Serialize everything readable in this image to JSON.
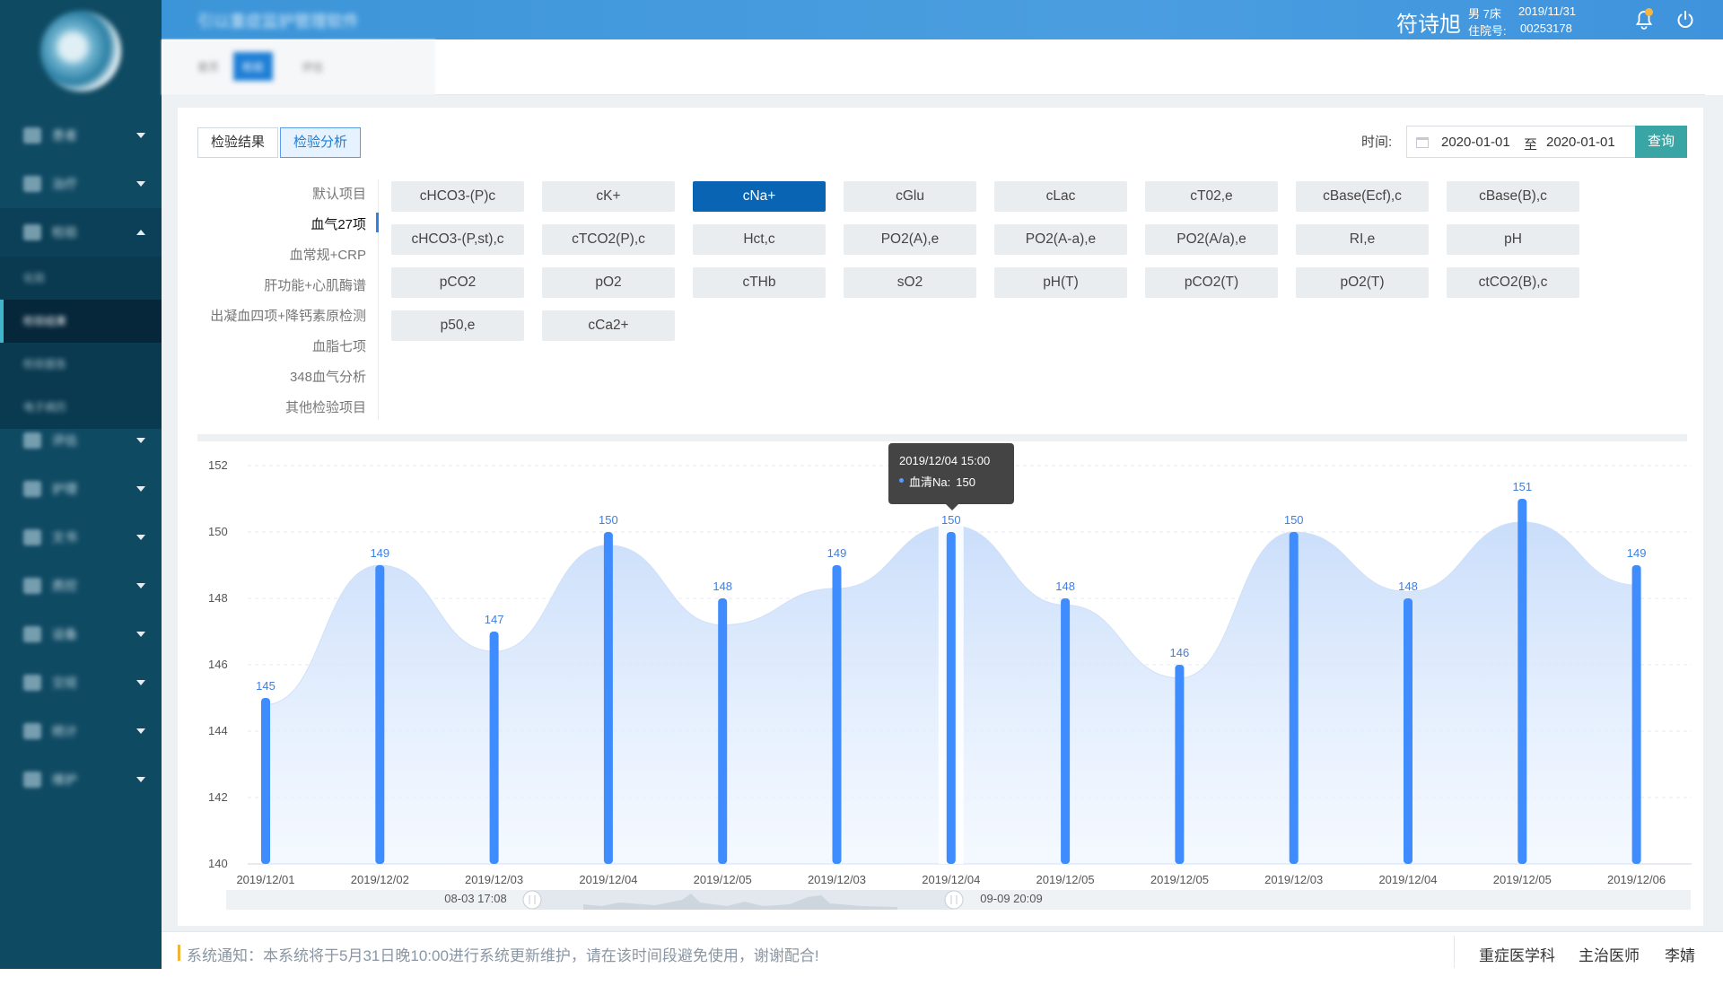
{
  "app": {
    "title": "引以重症监护管理软件",
    "patient_name": "符诗旭",
    "patient_gender_bed": "男 7床",
    "patient_date": "2019/11/31",
    "admission_label": "住院号:",
    "admission_no": "00253178",
    "colors": {
      "header": "#4a9ee0",
      "sidebar": "#0f4a63",
      "accent": "#0a64b4",
      "query": "#3aa5a5",
      "bar": "#3f8cff"
    }
  },
  "sidebar": {
    "items": [
      {
        "label": "患者",
        "icon": "user-icon"
      },
      {
        "label": "治疗",
        "icon": "treatment-icon"
      },
      {
        "label": "检验",
        "icon": "lab-icon",
        "expanded": true
      },
      {
        "label": "评估",
        "icon": "assessment-icon"
      },
      {
        "label": "护理",
        "icon": "nursing-icon"
      },
      {
        "label": "文书",
        "icon": "document-icon"
      },
      {
        "label": "质控",
        "icon": "quality-icon"
      },
      {
        "label": "设备",
        "icon": "device-icon"
      },
      {
        "label": "交班",
        "icon": "handover-icon"
      },
      {
        "label": "统计",
        "icon": "stats-icon"
      },
      {
        "label": "维护",
        "icon": "maintenance-icon"
      }
    ],
    "sub_items": [
      {
        "label": "化验"
      },
      {
        "label": "检验结果"
      },
      {
        "label": "检验报告"
      },
      {
        "label": "电子病历"
      }
    ]
  },
  "tabstrip": {
    "tabs": [
      "首页",
      "检验",
      "评估"
    ]
  },
  "toolbar": {
    "seg_results": "检验结果",
    "seg_analysis": "检验分析",
    "time_label": "时间:",
    "date_from": "2020-01-01",
    "date_sep": "至",
    "date_to": "2020-01-01",
    "query": "查询"
  },
  "categories": [
    {
      "label": "默认项目"
    },
    {
      "label": "血气27项",
      "active": true
    },
    {
      "label": "血常规+CRP"
    },
    {
      "label": "肝功能+心肌酶谱"
    },
    {
      "label": "出凝血四项+降钙素原检测"
    },
    {
      "label": "血脂七项"
    },
    {
      "label": "348血气分析"
    },
    {
      "label": "其他检验项目"
    }
  ],
  "items": [
    "cHCO3-(P)c",
    "cK+",
    "cNa+",
    "cGlu",
    "cLac",
    "cT02,e",
    "cBase(Ecf),c",
    "cBase(B),c",
    "cHCO3-(P,st),c",
    "cTCO2(P),c",
    "Hct,c",
    "PO2(A),e",
    "PO2(A-a),e",
    "PO2(A/a),e",
    "RI,e",
    "pH",
    "pCO2",
    "pO2",
    "cTHb",
    "sO2",
    "pH(T)",
    "pCO2(T)",
    "pO2(T)",
    "ctCO2(B),c",
    "p50,e",
    "cCa2+"
  ],
  "active_item": "cNa+",
  "chart_data": {
    "type": "bar",
    "categories": [
      "2019/12/01",
      "2019/12/02",
      "2019/12/03",
      "2019/12/04",
      "2019/12/05",
      "2019/12/03",
      "2019/12/04",
      "2019/12/05",
      "2019/12/05",
      "2019/12/03",
      "2019/12/04",
      "2019/12/05",
      "2019/12/06"
    ],
    "series": [
      {
        "name": "血清Na",
        "values": [
          145,
          149,
          147,
          150,
          148,
          149,
          150,
          148,
          146,
          150,
          148,
          151,
          149
        ]
      }
    ],
    "smooth_area_values": [
      144.8,
      149.0,
      146.4,
      149.6,
      147.2,
      148.3,
      150.2,
      147.8,
      145.6,
      150.0,
      148.2,
      150.3,
      148.4
    ],
    "ylim": [
      140,
      152
    ],
    "yticks": [
      140,
      142,
      144,
      146,
      148,
      150,
      152
    ],
    "grid": true,
    "tooltip": {
      "date": "2019/12/04  15:00",
      "label": "血清Na:",
      "value": "150"
    },
    "zoom": {
      "start_label": "08-03 17:08",
      "end_label": "09-09 20:09"
    }
  },
  "footer": {
    "notice": "系统通知：本系统将于5月31日晚10:00进行系统更新维护，请在该时间段避免使用，谢谢配合!",
    "dept": "重症医学科",
    "role": "主治医师",
    "user": "李婧"
  }
}
